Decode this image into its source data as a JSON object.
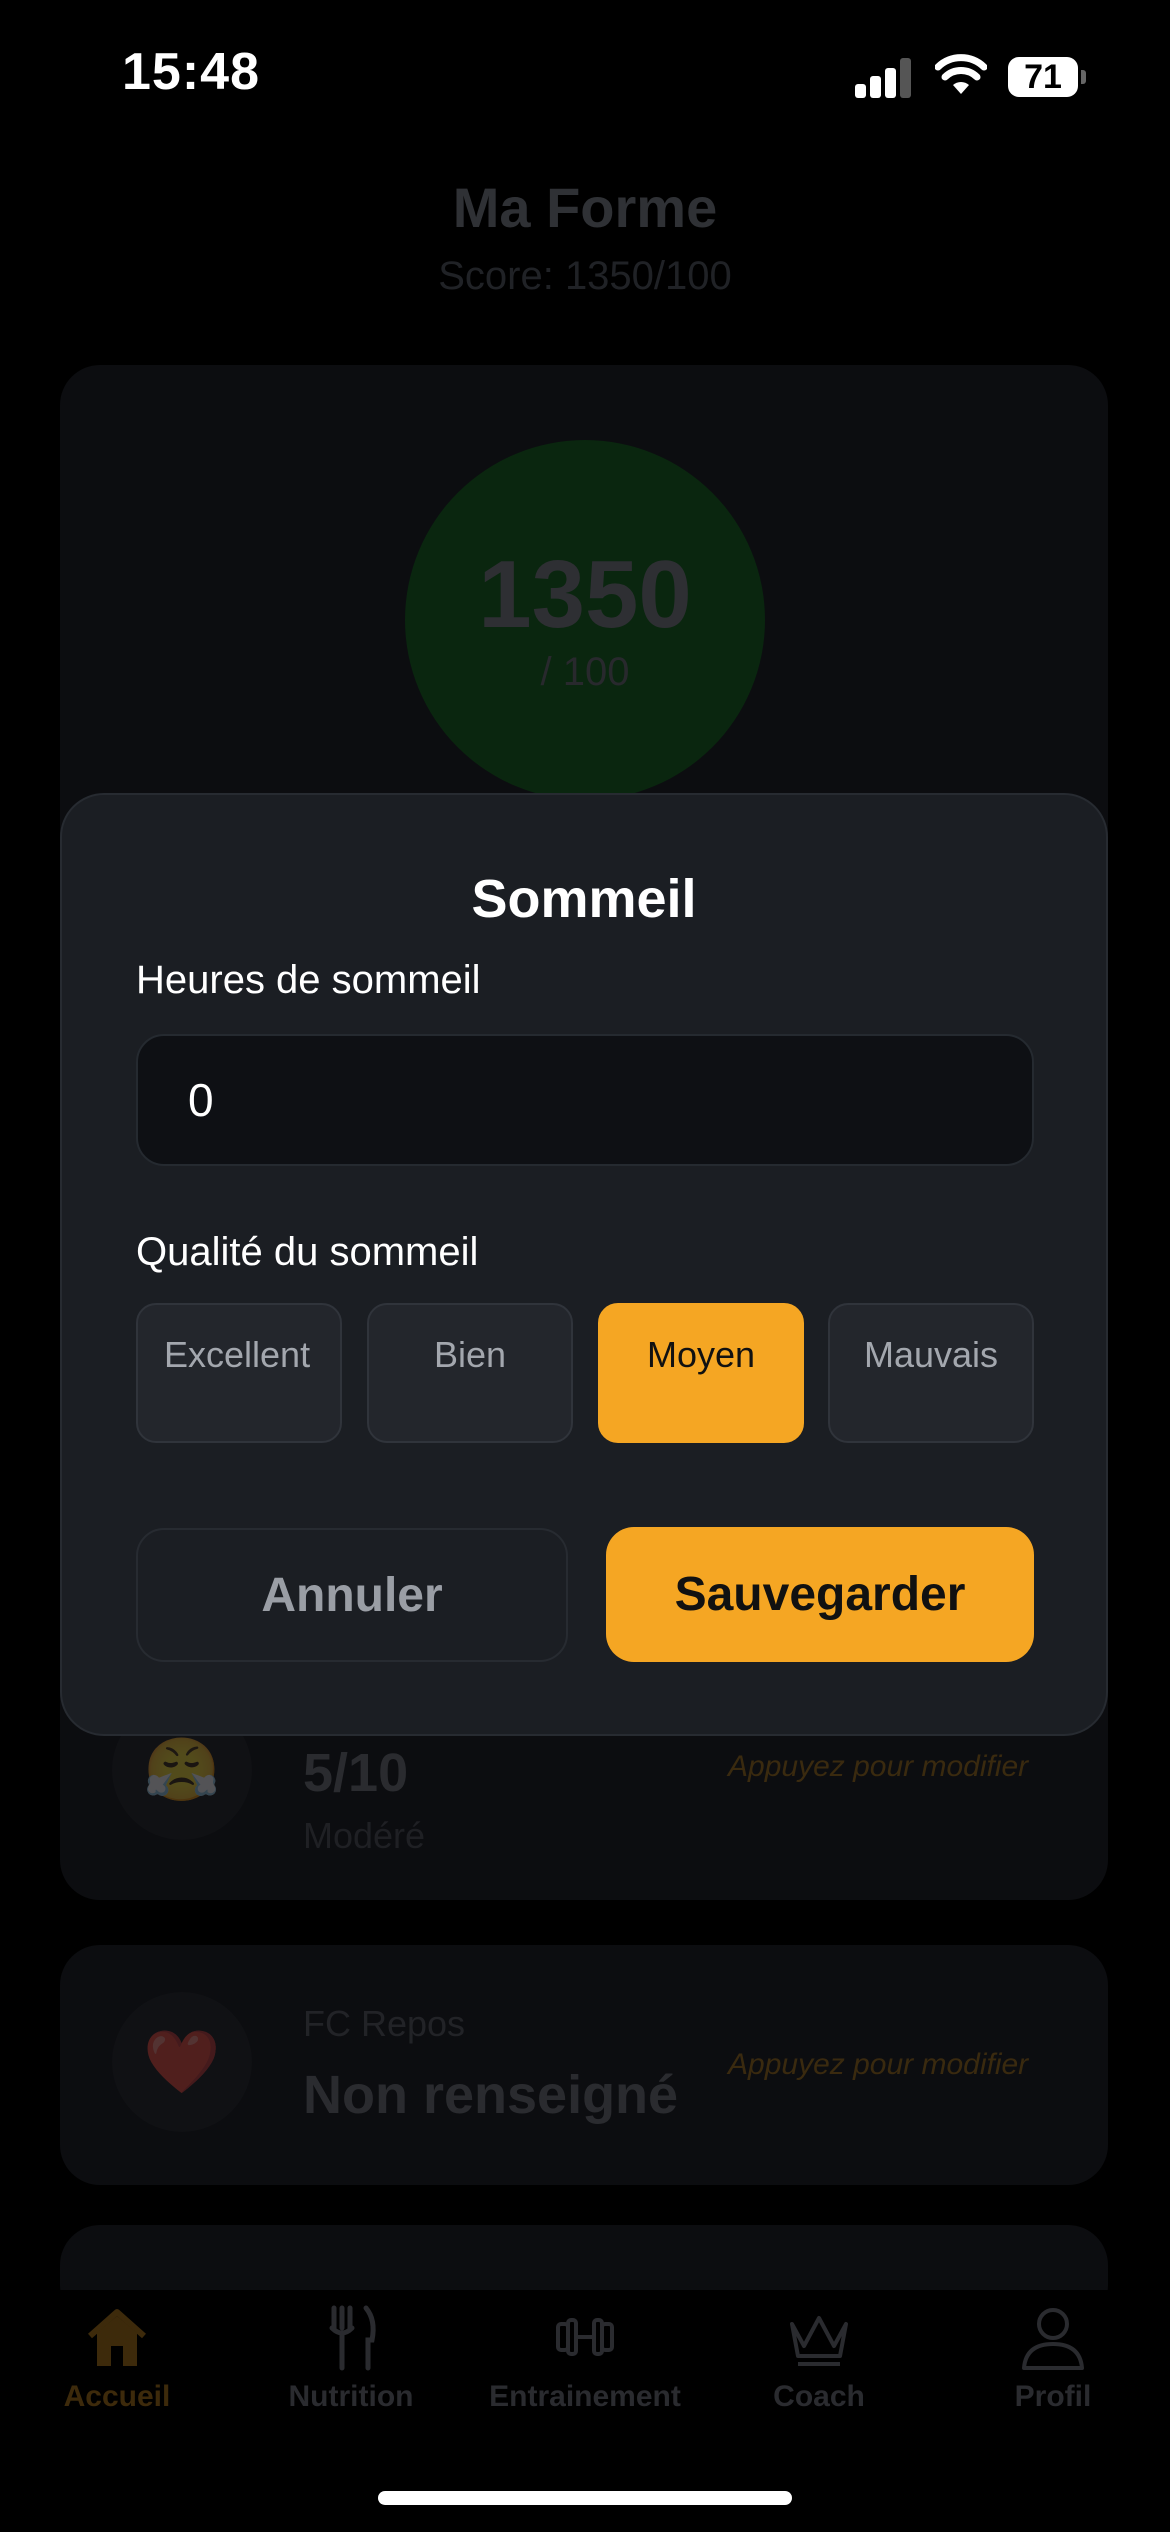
{
  "status_bar": {
    "time": "15:48",
    "battery": "71"
  },
  "page": {
    "title": "Ma Forme",
    "subtitle": "Score: 1350/100"
  },
  "score": {
    "value": "1350",
    "max": "/ 100"
  },
  "stress": {
    "value": "5/10",
    "label": "Modéré",
    "hint": "Appuyez pour modifier",
    "emoji": "😤"
  },
  "heart_rate": {
    "label": "FC Repos",
    "value": "Non renseigné",
    "hint": "Appuyez pour modifier",
    "emoji": "❤️"
  },
  "modal": {
    "title": "Sommeil",
    "hours_label": "Heures de sommeil",
    "hours_value": "0",
    "quality_label": "Qualité du sommeil",
    "quality_options": [
      "Excellent",
      "Bien",
      "Moyen",
      "Mauvais"
    ],
    "selected_quality": "Moyen",
    "cancel_label": "Annuler",
    "save_label": "Sauvegarder"
  },
  "nav": {
    "items": [
      {
        "label": "Accueil",
        "icon": "home-icon"
      },
      {
        "label": "Nutrition",
        "icon": "fork-knife-icon"
      },
      {
        "label": "Entrainement",
        "icon": "dumbbell-icon"
      },
      {
        "label": "Coach",
        "icon": "crown-icon"
      },
      {
        "label": "Profil",
        "icon": "person-icon"
      }
    ],
    "active": "Accueil"
  },
  "colors": {
    "accent": "#f5a623",
    "modal_bg": "#1b1e23",
    "background": "#000000"
  }
}
